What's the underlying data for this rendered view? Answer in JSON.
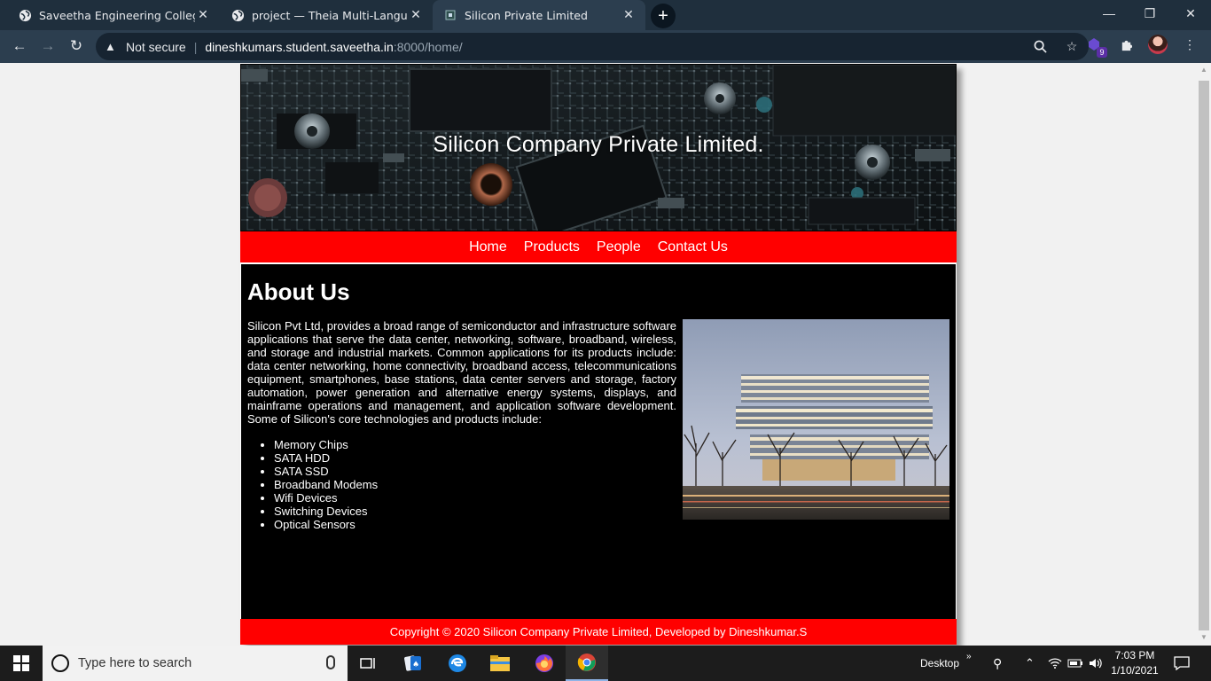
{
  "browser": {
    "tabs": [
      {
        "label": "Saveetha Engineering College",
        "icon": "globe-icon",
        "active": false
      },
      {
        "label": "project — Theia Multi-Language",
        "icon": "globe-icon",
        "active": false
      },
      {
        "label": "Silicon Private Limited",
        "icon": "site-favicon",
        "active": true
      }
    ],
    "security_label": "Not secure",
    "url_host": "dineshkumars.student.saveetha.in",
    "url_path": ":8000/home/",
    "extension_badge": "9"
  },
  "site": {
    "hero_title": "Silicon Company Private Limited.",
    "nav": [
      "Home",
      "Products",
      "People",
      "Contact Us"
    ],
    "heading": "About Us",
    "intro": "Silicon Pvt Ltd, provides a broad range of semiconductor and infrastructure software applications that serve the data center, networking, software, broadband, wireless, and storage and industrial markets. Common applications for its products include: data center networking, home connectivity, broadband access, telecommunications equipment, smartphones, base stations, data center servers and storage, factory automation, power generation and alternative energy systems, displays, and mainframe operations and management, and application software development. Some of Silicon's core technologies and products include:",
    "products": [
      "Memory Chips",
      "SATA HDD",
      "SATA SSD",
      "Broadband Modems",
      "Wifi Devices",
      "Switching Devices",
      "Optical Sensors"
    ],
    "footer": "Copyright © 2020 Silicon Company Private Limited, Developed by Dineshkumar.S"
  },
  "taskbar": {
    "search_placeholder": "Type here to search",
    "desktop_label": "Desktop",
    "time": "7:03 PM",
    "date": "1/10/2021"
  },
  "colors": {
    "accent_red": "#ff0000",
    "chrome_dark": "#1f2f3d",
    "content_bg": "#000000"
  }
}
